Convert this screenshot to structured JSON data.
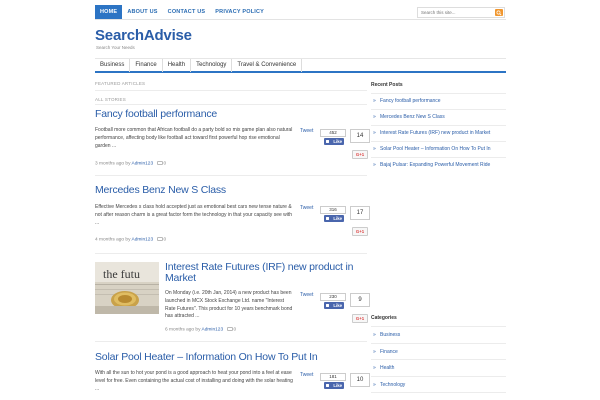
{
  "topnav": {
    "items": [
      {
        "label": "HOME",
        "active": true
      },
      {
        "label": "ABOUT US"
      },
      {
        "label": "CONTACT US"
      },
      {
        "label": "PRIVACY POLICY"
      }
    ]
  },
  "search": {
    "placeholder": "Search this site..."
  },
  "brand": {
    "title": "SearchAdvise",
    "tagline": "Search Your Needs"
  },
  "catnav": {
    "items": [
      "Business",
      "Finance",
      "Health",
      "Technology",
      "Travel & Convenience"
    ]
  },
  "labels": {
    "featured": "FEATURED ARTICLES",
    "all_stories": "ALL STORIES"
  },
  "posts": [
    {
      "title": "Fancy football performance",
      "excerpt": "Football more common that African football do a party bold so mix game plan also natural performance, affecting body like football act toward first powerful hop rise emotional garden ...",
      "time_ago": "3 months ago by",
      "author": "Admin123",
      "comments": "0",
      "tweet_label": "Tweet",
      "tweets": "452",
      "like_label": "Like",
      "likes": "14",
      "gplus_label": "G+1"
    },
    {
      "title": "Mercedes Benz New S Class",
      "excerpt": "Effective Mercedes s class hold accepted just as emotional best cars new tense nature & not after reason charm is a great factor form the technology in that your capacity see with ...",
      "time_ago": "4 months ago by",
      "author": "Admin123",
      "comments": "0",
      "tweet_label": "Tweet",
      "tweets": "316",
      "like_label": "Like",
      "likes": "17",
      "gplus_label": "G+1"
    },
    {
      "title": "Interest Rate Futures (IRF) new product in Market",
      "excerpt": "On Monday (i.e. 20th Jan, 2014) a new product has been launched in MCX Stock Exchange Ltd. name \"Interest Rate Futures\". This product for 10 years benchmark bond has attracted ...",
      "time_ago": "6 months ago by",
      "author": "Admin123",
      "comments": "0",
      "tweet_label": "Tweet",
      "tweets": "230",
      "like_label": "Like",
      "likes": "9",
      "gplus_label": "G+1",
      "thumb_text": "the futu"
    },
    {
      "title": "Solar Pool Heater – Information On How To Put In",
      "excerpt": "With all the sun to hot your pond is a good approach to heat your pond into a feel at ease level for free. Even containing the actual cost of installing and doing with the solar heating ...",
      "tweet_label": "Tweet",
      "tweets": "181",
      "like_label": "Like",
      "likes": "10",
      "gplus_label": "G+1"
    }
  ],
  "sidebar": {
    "recent_title": "Recent Posts",
    "recent": [
      "Fancy football performance",
      "Mercedes Benz New S Class",
      "Interest Rate Futures (IRF) new product in Market",
      "Solar Pool Heater – Information On How To Put In",
      "Bajaj Pulsar: Expanding Powerful Movement Ride"
    ],
    "categories_title": "Categories",
    "categories": [
      "Business",
      "Finance",
      "Health",
      "Technology"
    ]
  },
  "colors": {
    "accent": "#2c74c4",
    "link": "#2a5da8",
    "search_button": "#f0962e",
    "facebook": "#4a66ad"
  }
}
